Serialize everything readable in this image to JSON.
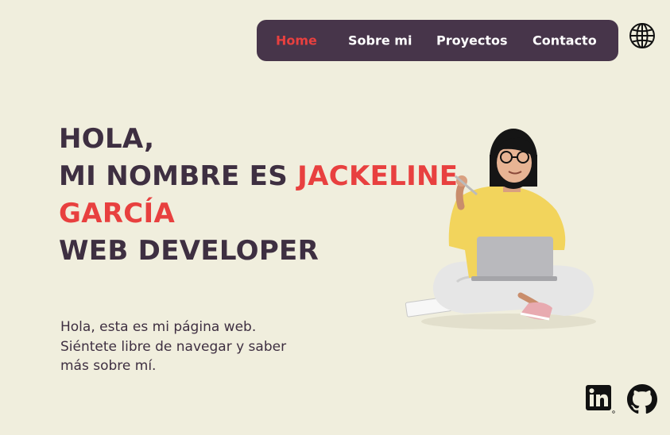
{
  "nav": {
    "items": [
      {
        "label": "Home",
        "active": true
      },
      {
        "label": "Sobre mi",
        "active": false
      },
      {
        "label": "Proyectos",
        "active": false
      },
      {
        "label": "Contacto",
        "active": false
      }
    ]
  },
  "language_icon": "globe-icon",
  "hero": {
    "line1": "HOLA,",
    "line2_prefix": "MI NOMBRE ES ",
    "line2_name": "JACKELINE",
    "line3_name": "GARCÍA",
    "line4": "WEB DEVELOPER"
  },
  "intro": {
    "line1": "Hola, esta es mi página web.",
    "line2": "Siéntete libre de navegar y saber",
    "line3": "más sobre mí."
  },
  "social": {
    "linkedin_icon": "linkedin-icon",
    "github_icon": "github-icon"
  },
  "colors": {
    "background": "#f0eedd",
    "nav_bg": "#47354a",
    "accent": "#e8403f",
    "text_dark": "#3e2f41"
  }
}
